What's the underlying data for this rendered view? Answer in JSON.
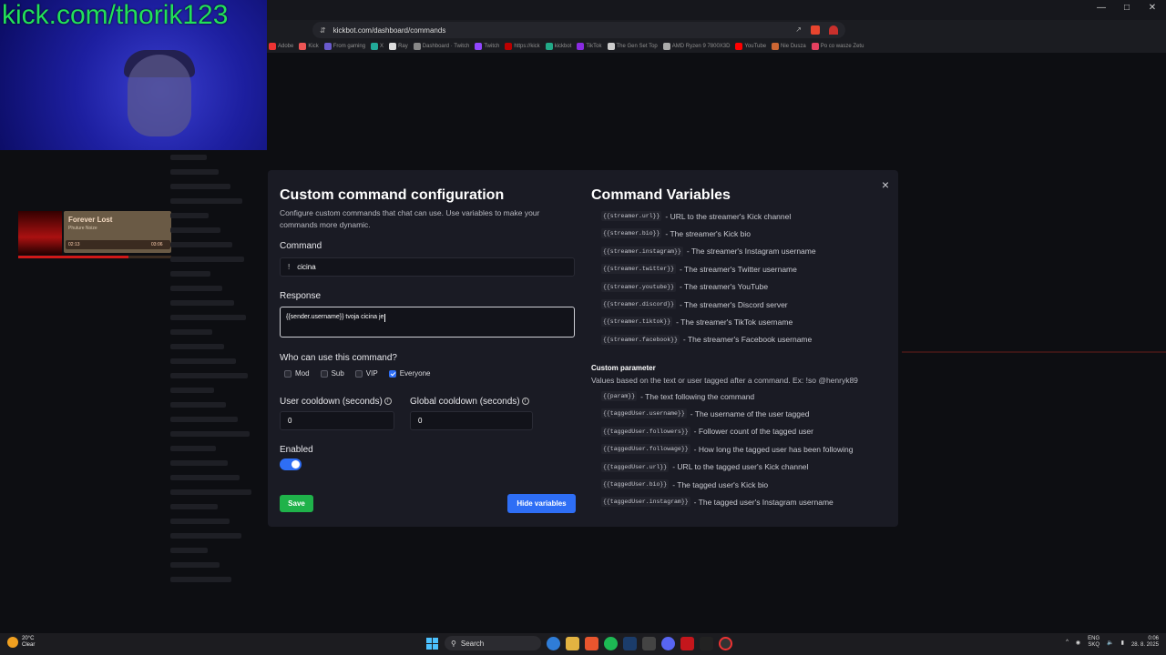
{
  "overlay": {
    "kick_url": "kick.com/thorik123",
    "music": {
      "title": "Forever Lost",
      "artist": "Phuture Noize",
      "elapsed": "02:13",
      "duration": "03:06",
      "progress": 0.72
    }
  },
  "browser": {
    "url": "kickbot.com/dashboard/commands",
    "bookmarks": [
      "Adobe",
      "Kick",
      "From gaming",
      "X",
      "Ray",
      "Dashboard · Twitch",
      "Twitch",
      "https://kick",
      "kickbot",
      "TikTok",
      "The Gen Set Top",
      "AMD Ryzen 9 7800X3D",
      "YouTube",
      "Nie Dusza",
      "Po co wasze Zetu"
    ]
  },
  "modal": {
    "title": "Custom command configuration",
    "description": "Configure custom commands that chat can use. Use variables to make your commands more dynamic.",
    "command_label": "Command",
    "command_prefix": "!",
    "command_value": "cicina",
    "response_label": "Response",
    "response_value": "{{sender.username}} tvoja cicina je",
    "who_label": "Who can use this command?",
    "roles": [
      {
        "label": "Mod",
        "checked": false
      },
      {
        "label": "Sub",
        "checked": false
      },
      {
        "label": "VIP",
        "checked": false
      },
      {
        "label": "Everyone",
        "checked": true
      }
    ],
    "user_cooldown_label": "User cooldown (seconds)",
    "user_cooldown_value": "0",
    "global_cooldown_label": "Global cooldown (seconds)",
    "global_cooldown_value": "0",
    "enabled_label": "Enabled",
    "enabled": true,
    "save_label": "Save",
    "hide_label": "Hide variables",
    "close_glyph": "×"
  },
  "variables": {
    "title": "Command Variables",
    "items": [
      {
        "code": "{{streamer.url}}",
        "desc": "- URL to the streamer's Kick channel"
      },
      {
        "code": "{{streamer.bio}}",
        "desc": "- The streamer's Kick bio"
      },
      {
        "code": "{{streamer.instagram}}",
        "desc": "- The streamer's Instagram username"
      },
      {
        "code": "{{streamer.twitter}}",
        "desc": "- The streamer's Twitter username"
      },
      {
        "code": "{{streamer.youtube}}",
        "desc": "- The streamer's YouTube"
      },
      {
        "code": "{{streamer.discord}}",
        "desc": "- The streamer's Discord server"
      },
      {
        "code": "{{streamer.tiktok}}",
        "desc": "- The streamer's TikTok username"
      },
      {
        "code": "{{streamer.facebook}}",
        "desc": "- The streamer's Facebook username"
      }
    ],
    "param_title": "Custom parameter",
    "param_desc": "Values based on the text or user tagged after a command. Ex: !so @henryk89",
    "param_items": [
      {
        "code": "{{param}}",
        "desc": "- The text following the command"
      },
      {
        "code": "{{taggedUser.username}}",
        "desc": "- The username of the user tagged"
      },
      {
        "code": "{{taggedUser.followers}}",
        "desc": "- Follower count of the tagged user"
      },
      {
        "code": "{{taggedUser.followage}}",
        "desc": "- How long the tagged user has been following"
      },
      {
        "code": "{{taggedUser.url}}",
        "desc": "- URL to the tagged user's Kick channel"
      },
      {
        "code": "{{taggedUser.bio}}",
        "desc": "- The tagged user's Kick bio"
      },
      {
        "code": "{{taggedUser.instagram}}",
        "desc": "- The tagged user's Instagram username"
      }
    ]
  },
  "taskbar": {
    "weather_temp": "20°C",
    "weather_cond": "Clear",
    "search_label": "Search",
    "lang_1": "ENG",
    "lang_2": "SKQ",
    "time": "0:06",
    "date": "28. 8. 2025"
  },
  "colors": {
    "accent_blue": "#2e6ef5",
    "save_green": "#1fb24a",
    "kick_green": "#22e05a"
  }
}
